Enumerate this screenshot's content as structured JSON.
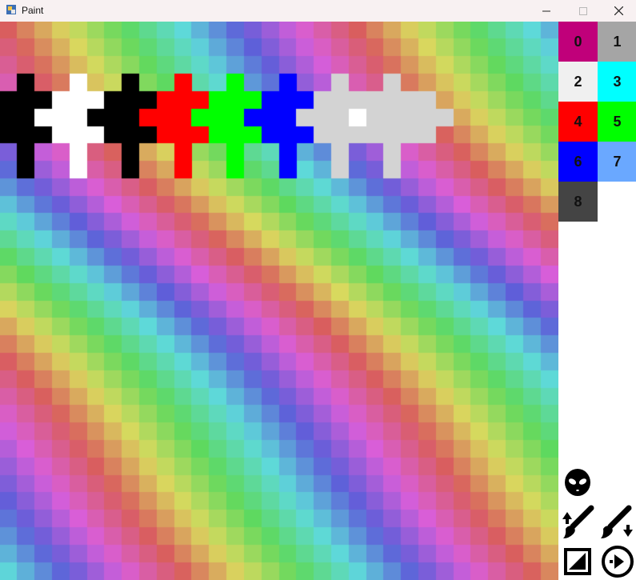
{
  "window": {
    "title": "Paint"
  },
  "canvas": {
    "columns": 32,
    "rows": 32,
    "background": "rainbow-diagonal-gradient",
    "stamp_colors": [
      "#000000",
      "#ffffff",
      "#000000",
      "#ff0000",
      "#00ff00",
      "#0000ff",
      "#d3d3d3"
    ]
  },
  "palette": {
    "swatches": [
      {
        "label": "0",
        "color": "#c0007a"
      },
      {
        "label": "1",
        "color": "#a5a5a5"
      },
      {
        "label": "2",
        "color": "#f0f0f0"
      },
      {
        "label": "3",
        "color": "#00ffff"
      },
      {
        "label": "4",
        "color": "#ff0000"
      },
      {
        "label": "5",
        "color": "#00ff00"
      },
      {
        "label": "6",
        "color": "#0000ff"
      },
      {
        "label": "7",
        "color": "#6aa8ff"
      },
      {
        "label": "8",
        "color": "#444444"
      }
    ]
  },
  "tools": [
    {
      "name": "alien-icon"
    },
    {
      "name": "brush-up-icon"
    },
    {
      "name": "brush-down-icon"
    },
    {
      "name": "expand-icon"
    },
    {
      "name": "play-icon"
    }
  ]
}
